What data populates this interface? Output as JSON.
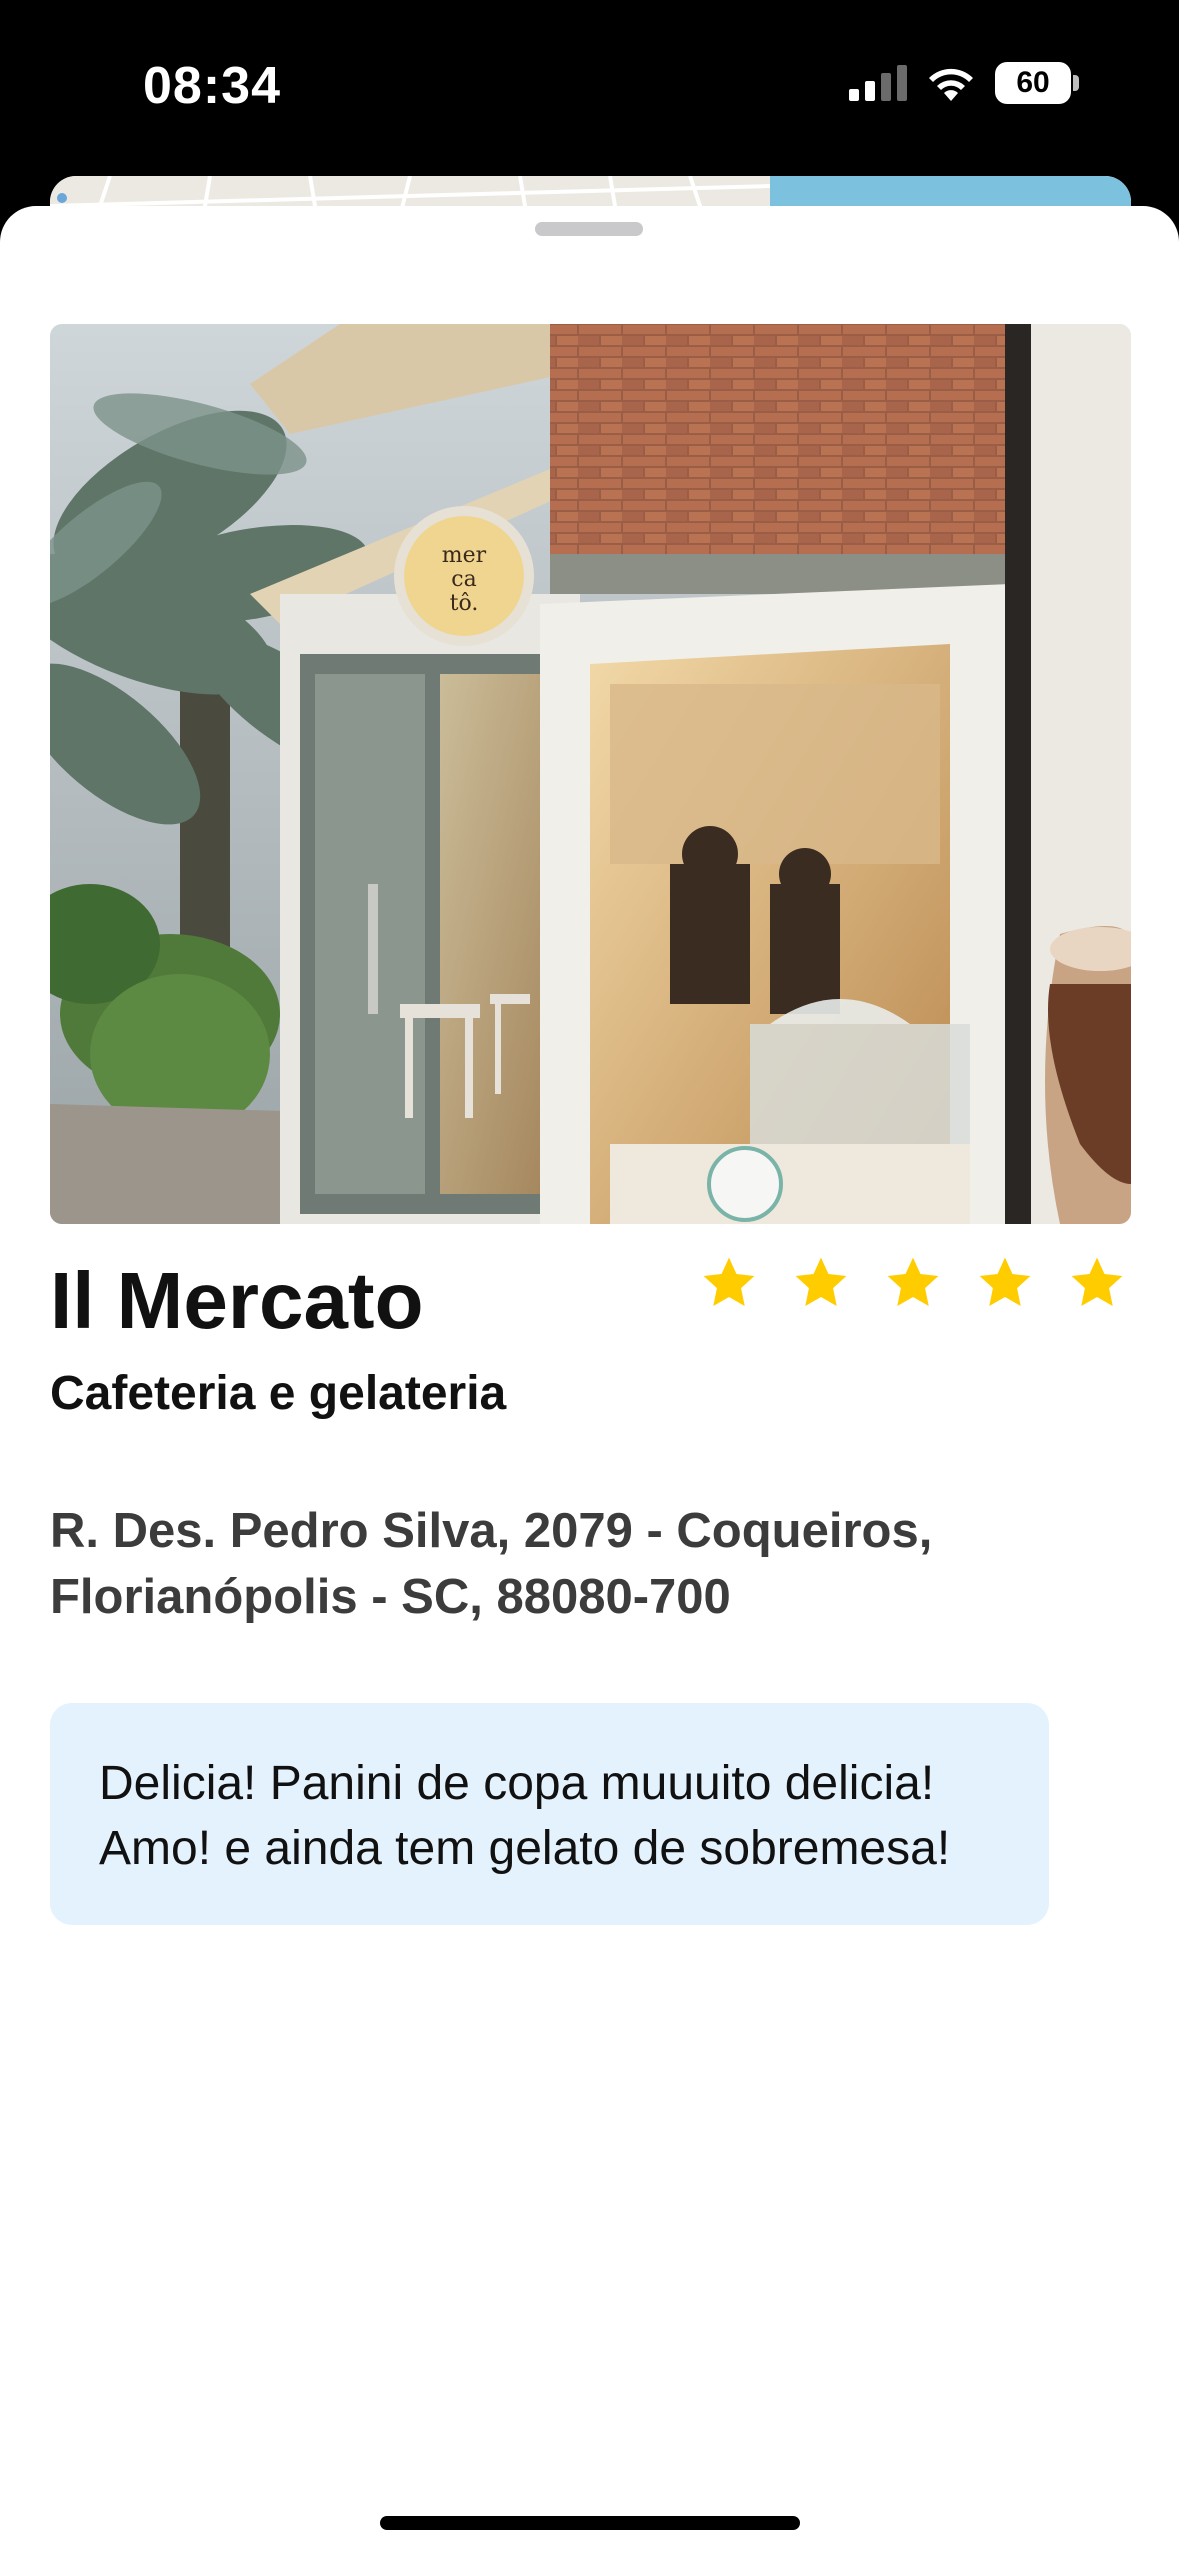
{
  "status_bar": {
    "time": "08:34",
    "battery": "60",
    "signal_icon": "cellular-signal-icon",
    "wifi_icon": "wifi-icon"
  },
  "place": {
    "name": "Il Mercato",
    "category": "Cafeteria e gelateria",
    "rating": 5,
    "rating_max": 5,
    "star_color": "#FFCC00",
    "address_lines": [
      "R. Des. Pedro Silva, 2079 - Coqueiros,",
      "Florianópolis - SC, 88080-700"
    ],
    "photo_sign_text": [
      "mer",
      "ca",
      "tô."
    ]
  },
  "review": {
    "lines": [
      "Delicia! Panini de copa muuuito delicia!",
      "Amo! e ainda tem gelato de sobremesa!"
    ],
    "background": "#E3F2FD"
  }
}
